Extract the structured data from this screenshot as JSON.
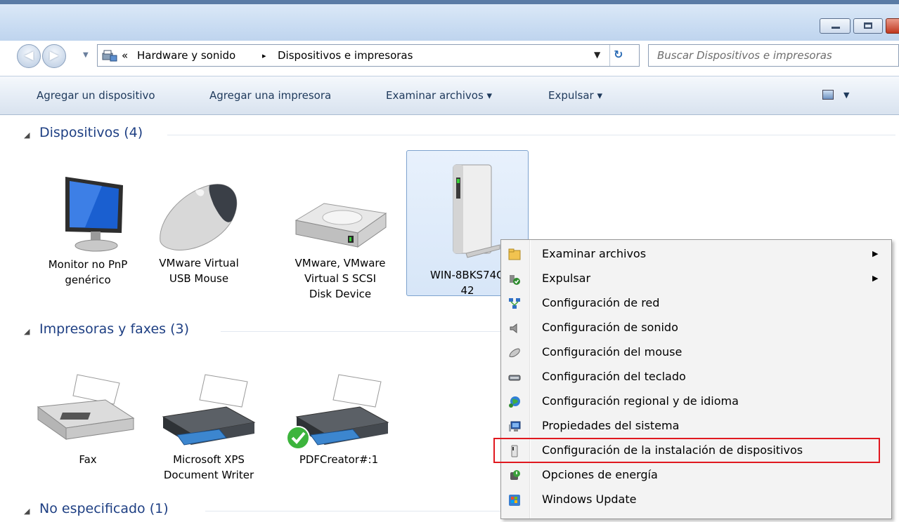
{
  "address": {
    "crumbs": [
      "«",
      "Hardware y sonido",
      "▸",
      "Dispositivos e impresoras"
    ],
    "search_placeholder": "Buscar Dispositivos e impresoras"
  },
  "toolbar": {
    "add_device": "Agregar un dispositivo",
    "add_printer": "Agregar una impresora",
    "browse_files": "Examinar archivos ▾",
    "eject": "Expulsar ▾"
  },
  "groups": {
    "devices": "Dispositivos (4)",
    "printers": "Impresoras y faxes (3)",
    "unspecified": "No especificado (1)"
  },
  "devices": [
    {
      "line1": "Monitor no PnP",
      "line2": "genérico",
      "line3": ""
    },
    {
      "line1": "VMware Virtual",
      "line2": "USB Mouse",
      "line3": ""
    },
    {
      "line1": "VMware, VMware",
      "line2": "Virtual S SCSI",
      "line3": "Disk Device"
    },
    {
      "line1": "WIN-8BKS74Q",
      "line2": "42",
      "line3": ""
    }
  ],
  "printers": [
    {
      "line1": "Fax",
      "line2": ""
    },
    {
      "line1": "Microsoft XPS",
      "line2": "Document Writer"
    },
    {
      "line1": "PDFCreator#:1",
      "line2": ""
    }
  ],
  "context_menu": {
    "items": [
      {
        "label": "Examinar archivos",
        "icon": "folder-icon",
        "has_submenu": true
      },
      {
        "label": "Expulsar",
        "icon": "eject-icon",
        "has_submenu": true
      },
      {
        "label": "Configuración de red",
        "icon": "network-icon",
        "has_submenu": false
      },
      {
        "label": "Configuración de sonido",
        "icon": "speaker-icon",
        "has_submenu": false
      },
      {
        "label": "Configuración del mouse",
        "icon": "mouse-icon",
        "has_submenu": false
      },
      {
        "label": "Configuración del teclado",
        "icon": "keyboard-icon",
        "has_submenu": false
      },
      {
        "label": "Configuración regional y de idioma",
        "icon": "globe-icon",
        "has_submenu": false
      },
      {
        "label": "Propiedades del sistema",
        "icon": "computer-icon",
        "has_submenu": false
      },
      {
        "label": "Configuración de la instalación de dispositivos",
        "icon": "device-icon",
        "has_submenu": false
      },
      {
        "label": "Opciones de energía",
        "icon": "power-icon",
        "has_submenu": false
      },
      {
        "label": "Windows Update",
        "icon": "windows-update-icon",
        "has_submenu": false
      }
    ],
    "highlighted_index": 8
  },
  "colors": {
    "group_header": "#1e3f83",
    "command_text": "#1e395b",
    "highlight_box": "#e0181f",
    "selection_border": "#7da2ce"
  }
}
